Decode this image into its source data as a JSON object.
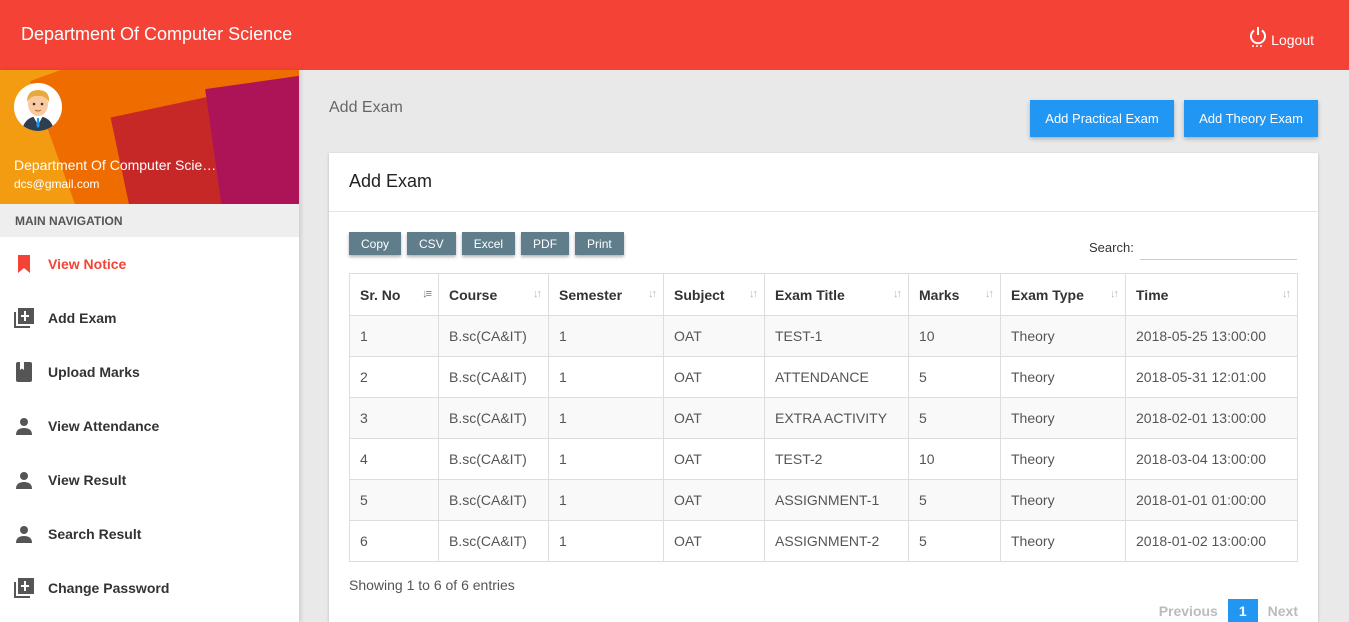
{
  "header": {
    "title": "Department Of Computer Science",
    "logout_label": "Logout"
  },
  "profile": {
    "name": "Department Of Computer Scie…",
    "email": "dcs@gmail.com"
  },
  "sidebar": {
    "heading": "MAIN NAVIGATION",
    "items": [
      {
        "label": "View Notice",
        "icon": "bookmark-icon",
        "active": true
      },
      {
        "label": "Add Exam",
        "icon": "add-box-icon"
      },
      {
        "label": "Upload Marks",
        "icon": "book-icon"
      },
      {
        "label": "View Attendance",
        "icon": "person-icon"
      },
      {
        "label": "View Result",
        "icon": "person-icon"
      },
      {
        "label": "Search Result",
        "icon": "person-icon"
      },
      {
        "label": "Change Password",
        "icon": "add-box-icon"
      }
    ]
  },
  "page": {
    "breadcrumb": "Add Exam",
    "add_practical_label": "Add Practical Exam",
    "add_theory_label": "Add Theory Exam",
    "card_title": "Add Exam"
  },
  "export_buttons": [
    "Copy",
    "CSV",
    "Excel",
    "PDF",
    "Print"
  ],
  "search_label": "Search:",
  "table": {
    "columns": [
      "Sr. No",
      "Course",
      "Semester",
      "Subject",
      "Exam Title",
      "Marks",
      "Exam Type",
      "Time"
    ],
    "rows": [
      [
        "1",
        "B.sc(CA&IT)",
        "1",
        "OAT",
        "TEST-1",
        "10",
        "Theory",
        "2018-05-25 13:00:00"
      ],
      [
        "2",
        "B.sc(CA&IT)",
        "1",
        "OAT",
        "ATTENDANCE",
        "5",
        "Theory",
        "2018-05-31 12:01:00"
      ],
      [
        "3",
        "B.sc(CA&IT)",
        "1",
        "OAT",
        "EXTRA ACTIVITY",
        "5",
        "Theory",
        "2018-02-01 13:00:00"
      ],
      [
        "4",
        "B.sc(CA&IT)",
        "1",
        "OAT",
        "TEST-2",
        "10",
        "Theory",
        "2018-03-04 13:00:00"
      ],
      [
        "5",
        "B.sc(CA&IT)",
        "1",
        "OAT",
        "ASSIGNMENT-1",
        "5",
        "Theory",
        "2018-01-01 01:00:00"
      ],
      [
        "6",
        "B.sc(CA&IT)",
        "1",
        "OAT",
        "ASSIGNMENT-2",
        "5",
        "Theory",
        "2018-01-02 13:00:00"
      ]
    ]
  },
  "table_info": "Showing 1 to 6 of 6 entries",
  "pagination": {
    "previous": "Previous",
    "current": "1",
    "next": "Next"
  },
  "colors": {
    "header": "#f44336",
    "primary_button": "#2196f3",
    "export_button": "#607d8b"
  }
}
